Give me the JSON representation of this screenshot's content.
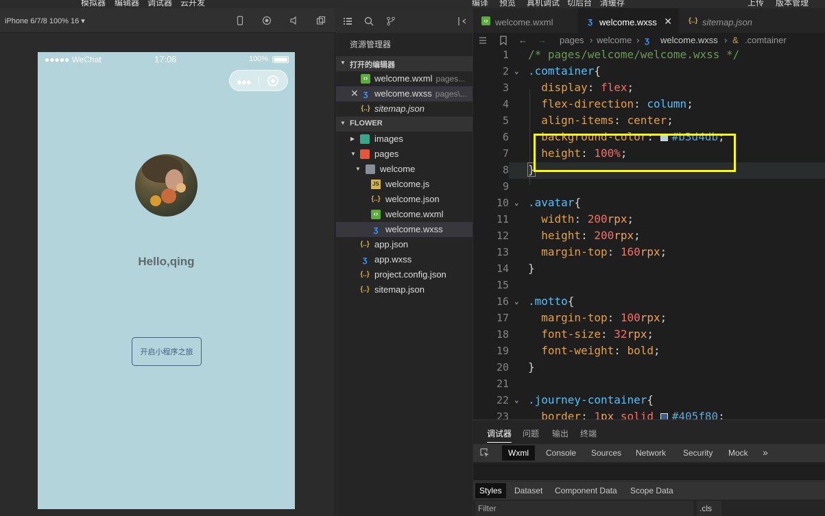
{
  "menubar": {
    "left": [
      "模拟器",
      "编辑器",
      "调试器",
      "云开发"
    ],
    "right": [
      "编译",
      "预览",
      "真机调试",
      "切后台",
      "清缓存",
      "上传",
      "版本管理"
    ]
  },
  "simulator": {
    "device": "iPhone 6/7/8 100% 16 ▾",
    "status": {
      "carrier": "●●●●● WeChat",
      "time": "17:06",
      "battery": "100%"
    },
    "page": {
      "motto": "Hello,qing",
      "button": "开启小程序之旅",
      "background_color": "#b3d4db"
    }
  },
  "explorer": {
    "title": "资源管理器",
    "open_editors_label": "打开的编辑器",
    "open_editors": [
      {
        "name": "welcome.wxml",
        "path": "pages...",
        "icon": "wxml-icon"
      },
      {
        "name": "welcome.wxss",
        "path": "pages\\...",
        "icon": "wxss-icon"
      },
      {
        "name": "sitemap.json",
        "icon": "json-icon"
      }
    ],
    "project_label": "FLOWER",
    "tree": [
      {
        "name": "images",
        "icon": "folder-images-icon"
      },
      {
        "name": "pages",
        "icon": "folder-pages-icon"
      },
      {
        "name": "welcome",
        "icon": "folder-icon"
      },
      {
        "name": "welcome.js",
        "icon": "js-icon"
      },
      {
        "name": "welcome.json",
        "icon": "json-icon"
      },
      {
        "name": "welcome.wxml",
        "icon": "wxml-icon"
      },
      {
        "name": "welcome.wxss",
        "icon": "wxss-icon"
      },
      {
        "name": "app.json",
        "icon": "json-icon"
      },
      {
        "name": "app.wxss",
        "icon": "wxss-icon"
      },
      {
        "name": "project.config.json",
        "icon": "json-icon"
      },
      {
        "name": "sitemap.json",
        "icon": "json-icon"
      }
    ]
  },
  "editor": {
    "tabs": [
      {
        "label": "welcome.wxml"
      },
      {
        "label": "welcome.wxss",
        "close": "✕"
      },
      {
        "label": "sitemap.json"
      }
    ],
    "breadcrumb": [
      "pages",
      "welcome",
      "welcome.wxss",
      ".comtainer"
    ],
    "line_numbers": [
      "1",
      "2",
      "3",
      "4",
      "5",
      "6",
      "7",
      "8",
      "9",
      "10",
      "11",
      "12",
      "13",
      "14",
      "15",
      "16",
      "17",
      "18",
      "19",
      "20",
      "21",
      "22",
      "23"
    ],
    "lines": {
      "l1": "/* pages/welcome/welcome.wxss */",
      "l2_sel": ".comtainer",
      "l3_prop": "display",
      "l3_val": "flex",
      "l4_prop": "flex-direction",
      "l4_val": "column",
      "l5_prop": "align-items",
      "l5_val": "center",
      "l6_prop": "background-color",
      "l6_val": "#b3d4db",
      "l7_prop": "height",
      "l7_num": "100%",
      "l10_sel": ".avatar",
      "l11_prop": "width",
      "l11_num": "200",
      "l11_unit": "rpx",
      "l12_prop": "height",
      "l12_num": "200",
      "l12_unit": "rpx",
      "l13_prop": "margin-top",
      "l13_num": "160",
      "l13_unit": "rpx",
      "l16_sel": ".motto",
      "l17_prop": "margin-top",
      "l17_num": "100",
      "l17_unit": "rpx",
      "l18_prop": "font-size",
      "l18_num": "32",
      "l18_unit": "rpx",
      "l19_prop": "font-weight",
      "l19_val": "bold",
      "l22_sel": ".journey-container",
      "l23_prop": "border",
      "l23_num": "1",
      "l23_unit": "px",
      "l23_kw": "solid",
      "l23_val": "#405f80"
    },
    "punct": {
      "open": "{",
      "close": "}",
      "colon": ": ",
      "semi": ";"
    }
  },
  "debugger": {
    "tabs": [
      "调试器",
      "问题",
      "输出",
      "终端"
    ],
    "subtabs": [
      "Wxml",
      "Console",
      "Sources",
      "Network",
      "Security",
      "Mock",
      "»"
    ],
    "style_tabs": [
      "Styles",
      "Dataset",
      "Component Data",
      "Scope Data"
    ],
    "filter_placeholder": "Filter",
    "cls": ".cls"
  },
  "colors": {
    "page_background": "#b3d4db",
    "button_border": "#405f80",
    "highlight": "#ffff00"
  }
}
